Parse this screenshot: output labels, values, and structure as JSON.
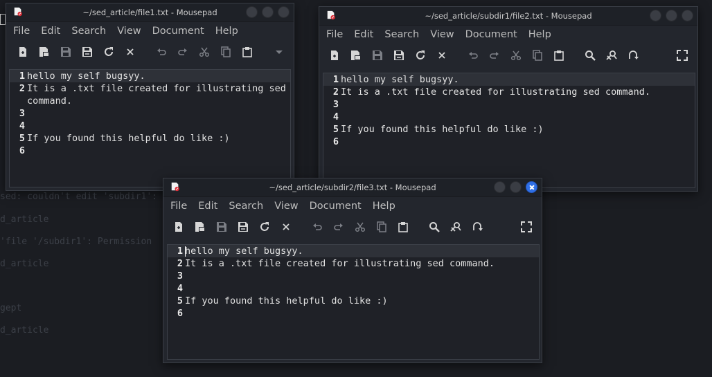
{
  "background_terminal": {
    "lines": [
      "sed: couldn't edit 'subdir1': not a regular file",
      "d_article",
      "'file '/subdir1': Permission",
      "d_article",
      "gept",
      "d_article"
    ]
  },
  "windows": [
    {
      "title": "~/sed_article/file1.txt - Mousepad",
      "menus": [
        "File",
        "Edit",
        "Search",
        "View",
        "Document",
        "Help"
      ],
      "lines": [
        {
          "n": "1",
          "text": "hello my self bugsyy."
        },
        {
          "n": "2",
          "text": "It is a .txt file created for illustrating sed"
        },
        {
          "n": "",
          "text": "command."
        },
        {
          "n": "3",
          "text": ""
        },
        {
          "n": "4",
          "text": ""
        },
        {
          "n": "5",
          "text": "If you found this helpful do like :)"
        },
        {
          "n": "6",
          "text": ""
        }
      ]
    },
    {
      "title": "~/sed_article/subdir1/file2.txt - Mousepad",
      "menus": [
        "File",
        "Edit",
        "Search",
        "View",
        "Document",
        "Help"
      ],
      "lines": [
        {
          "n": "1",
          "text": "hello my self bugsyy."
        },
        {
          "n": "2",
          "text": "It is a .txt file created for illustrating sed command."
        },
        {
          "n": "3",
          "text": ""
        },
        {
          "n": "4",
          "text": ""
        },
        {
          "n": "5",
          "text": "If you found this helpful do like :)"
        },
        {
          "n": "6",
          "text": ""
        }
      ]
    },
    {
      "title": "~/sed_article/subdir2/file3.txt - Mousepad",
      "menus": [
        "File",
        "Edit",
        "Search",
        "View",
        "Document",
        "Help"
      ],
      "lines": [
        {
          "n": "1",
          "text": "hello my self bugsyy."
        },
        {
          "n": "2",
          "text": "It is a .txt file created for illustrating sed command."
        },
        {
          "n": "3",
          "text": ""
        },
        {
          "n": "4",
          "text": ""
        },
        {
          "n": "5",
          "text": "If you found this helpful do like :)"
        },
        {
          "n": "6",
          "text": ""
        }
      ]
    }
  ],
  "colors": {
    "desktop": "#1b1d22",
    "window": "#23262d",
    "editor": "#1f2127",
    "current_line": "#2e3138",
    "close_active": "#2f6fe6",
    "app_icon_red": "#e0303a"
  }
}
